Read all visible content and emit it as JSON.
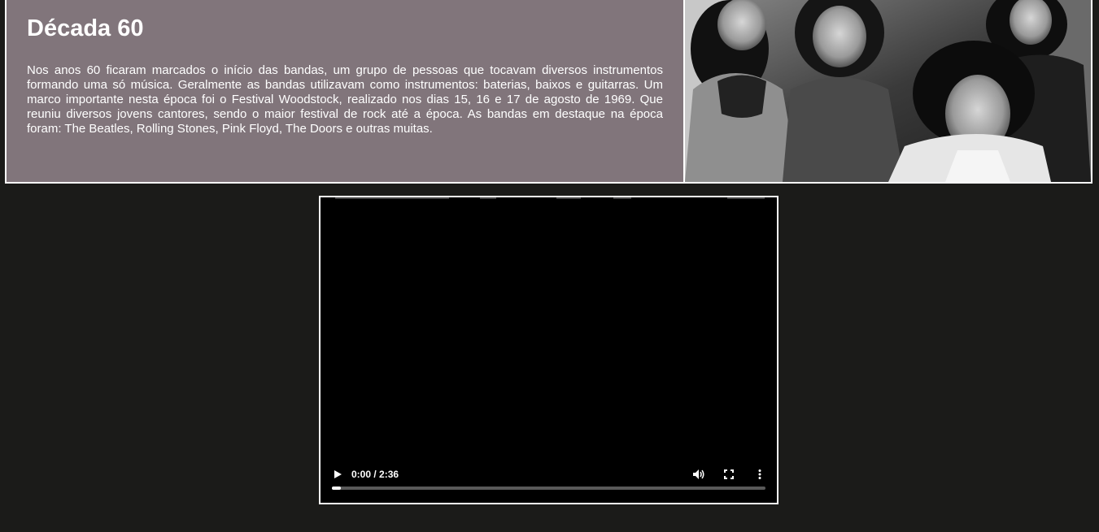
{
  "article": {
    "title": "Década 60",
    "body": "Nos anos 60 ficaram marcados o início das bandas, um grupo de pessoas que tocavam diversos instrumentos formando uma só música. Geralmente as bandas utilizavam como instrumentos: baterias, baixos e guitarras. Um marco importante nesta época foi o Festival Woodstock, realizado nos dias 15, 16 e 17 de agosto de 1969. Que reuniu diversos jovens cantores, sendo o maior festival de rock até a época. As bandas em destaque na época foram: The Beatles, Rolling Stones, Pink Floyd, The Doors e outras muitas."
  },
  "photo": {
    "icon": "band-photo"
  },
  "video": {
    "time_display": "0:00 / 2:36",
    "progress": 0.0,
    "play_icon": "play-icon",
    "volume_icon": "volume-icon",
    "fullscreen_icon": "fullscreen-icon",
    "more_icon": "more-options-icon"
  },
  "colors": {
    "page_background": "#1b1b19",
    "text_panel_background": "#81757b",
    "border": "#ffffff"
  }
}
